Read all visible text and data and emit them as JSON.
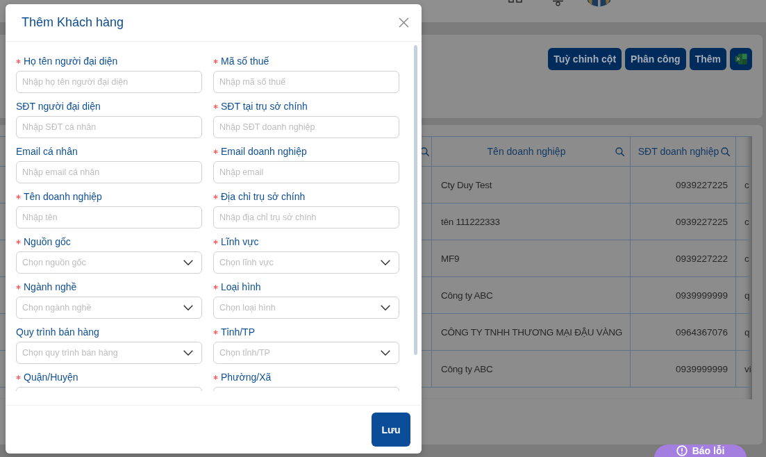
{
  "toolbar": {
    "buttons": [
      {
        "kind": "text",
        "label": "Tuỳ chỉnh cột"
      },
      {
        "kind": "text",
        "label": "Phân công"
      },
      {
        "kind": "text",
        "label": "Thêm"
      },
      {
        "kind": "spreadsheet"
      }
    ]
  },
  "table": {
    "leading_column": {
      "searchable": true
    },
    "columns": [
      {
        "label": "Tên doanh nghiệp",
        "searchable": true,
        "kind": "text"
      },
      {
        "label": "SĐT doanh nghiệp",
        "searchable": true,
        "kind": "number"
      },
      {
        "kind": "text"
      }
    ],
    "rows": [
      [
        "Cty Duy Test",
        "0939227225",
        "c"
      ],
      [
        "tên 111222333",
        "0939227225",
        "c"
      ],
      [
        "MF9",
        "0939227222",
        "c"
      ],
      [
        "Công ty ABC",
        "0939999999",
        "q"
      ],
      [
        "CÔNG TY TNHH THƯƠNG MẠI ĐẬU VÀNG",
        "0964367076",
        "q"
      ],
      [
        "Công ty ABC",
        "0939999999",
        "vi"
      ]
    ]
  },
  "dialog": {
    "title": "Thêm Khách hàng",
    "fields": [
      {
        "label": "Họ tên người đại diện",
        "required": true,
        "kind": "input",
        "placeholder": "Nhập họ tên người đại diện"
      },
      {
        "label": "Mã số thuế",
        "required": true,
        "kind": "input",
        "placeholder": "Nhập mã số thuế"
      },
      {
        "label": "SĐT người đại diện",
        "required": false,
        "kind": "input",
        "placeholder": "Nhập SĐT cá nhân"
      },
      {
        "label": "SĐT tại trụ sở chính",
        "required": true,
        "kind": "input",
        "placeholder": "Nhập SĐT doanh nghiệp"
      },
      {
        "label": "Email cá nhân",
        "required": false,
        "kind": "input",
        "placeholder": "Nhập email cá nhân"
      },
      {
        "label": "Email doanh nghiệp",
        "required": true,
        "kind": "input",
        "placeholder": "Nhập email"
      },
      {
        "label": "Tên doanh nghiệp",
        "required": true,
        "kind": "input",
        "placeholder": "Nhập tên"
      },
      {
        "label": "Địa chỉ trụ sở chính",
        "required": true,
        "kind": "input",
        "placeholder": "Nhập địa chỉ trụ sở chính"
      },
      {
        "label": "Nguồn gốc",
        "required": true,
        "kind": "select",
        "placeholder": "Chọn nguồn gốc"
      },
      {
        "label": "Lĩnh vực",
        "required": true,
        "kind": "select",
        "placeholder": "Chọn lĩnh vực"
      },
      {
        "label": "Ngành nghề",
        "required": true,
        "kind": "select",
        "placeholder": "Chọn ngành nghề"
      },
      {
        "label": "Loại hình",
        "required": true,
        "kind": "select",
        "placeholder": "Chọn loại hình"
      },
      {
        "label": "Quy trình bán hàng",
        "required": false,
        "kind": "select",
        "placeholder": "Chọn quy trình bán hàng"
      },
      {
        "label": "Tỉnh/TP",
        "required": true,
        "kind": "select",
        "placeholder": "Chọn tỉnh/TP"
      },
      {
        "label": "Quận/Huyện",
        "required": true,
        "kind": "input"
      },
      {
        "label": "Phường/Xã",
        "required": true,
        "kind": "input"
      }
    ],
    "footer_buttons": [
      {
        "label": "Lưu"
      }
    ]
  },
  "report_button": {
    "label": "Báo lỗi"
  }
}
